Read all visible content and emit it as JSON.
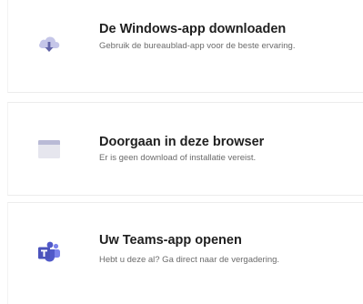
{
  "options": [
    {
      "icon": "cloud-download-icon",
      "title": "De Windows-app downloaden",
      "description": "Gebruik de bureaublad-app voor de beste ervaring."
    },
    {
      "icon": "browser-window-icon",
      "title": "Doorgaan in deze browser",
      "description": "Er is geen download of installatie vereist."
    },
    {
      "icon": "teams-logo-icon",
      "title": "Uw Teams-app openen",
      "description": "Hebt u deze al? Ga direct naar de vergadering."
    }
  ],
  "colors": {
    "accent": "#6264a7",
    "accent_light": "#c5c6e8",
    "title_text": "#1f1f1f",
    "description_text": "#6b6b6b"
  }
}
